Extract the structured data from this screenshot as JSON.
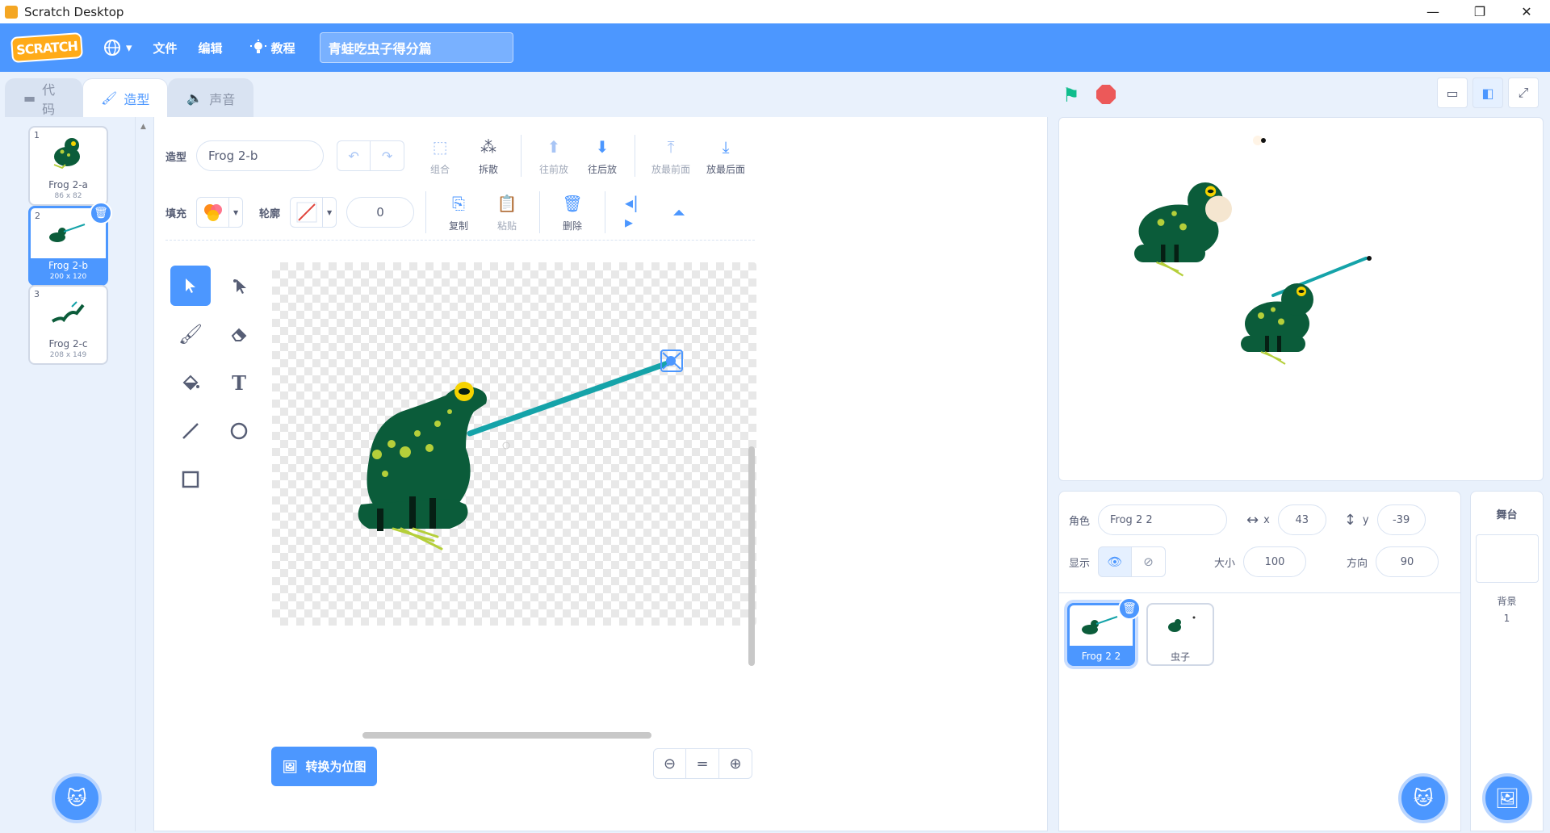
{
  "window": {
    "title": "Scratch Desktop",
    "controls": [
      "—",
      "❐",
      "✕"
    ]
  },
  "menubar": {
    "logo": "SCRATCH",
    "globe_icon": "globe-icon",
    "file": "文件",
    "edit": "编辑",
    "tutorials": "教程",
    "project_title": "青蛙吃虫子得分篇"
  },
  "tabs": {
    "code": "代码",
    "costumes": "造型",
    "sounds": "声音"
  },
  "costumes": [
    {
      "num": "1",
      "name": "Frog 2-a",
      "size": "86 x 82"
    },
    {
      "num": "2",
      "name": "Frog 2-b",
      "size": "200 x 120"
    },
    {
      "num": "3",
      "name": "Frog 2-c",
      "size": "208 x 149"
    }
  ],
  "editor": {
    "costume_label": "造型",
    "costume_name": "Frog 2-b",
    "group": "组合",
    "ungroup": "拆散",
    "forward": "往前放",
    "backward": "往后放",
    "front": "放最前面",
    "back": "放最后面",
    "fill_label": "填充",
    "outline_label": "轮廓",
    "outline_width": "0",
    "copy": "复制",
    "paste": "粘贴",
    "delete": "删除",
    "convert_bitmap": "转换为位图",
    "zoom_reset": "="
  },
  "sprite_info": {
    "sprite_label": "角色",
    "sprite_name": "Frog 2 2",
    "x_label": "x",
    "x_value": "43",
    "y_label": "y",
    "y_value": "-39",
    "show_label": "显示",
    "size_label": "大小",
    "size_value": "100",
    "direction_label": "方向",
    "direction_value": "90"
  },
  "sprites": [
    {
      "name": "Frog 2 2"
    },
    {
      "name": "虫子"
    }
  ],
  "stage_pane": {
    "title": "舞台",
    "backdrop_label": "背景",
    "backdrop_count": "1"
  },
  "colors": {
    "accent": "#4c97ff",
    "frog_dark": "#0b5c3a",
    "frog_spot": "#b5cf3a",
    "tongue": "#15a3a9"
  }
}
